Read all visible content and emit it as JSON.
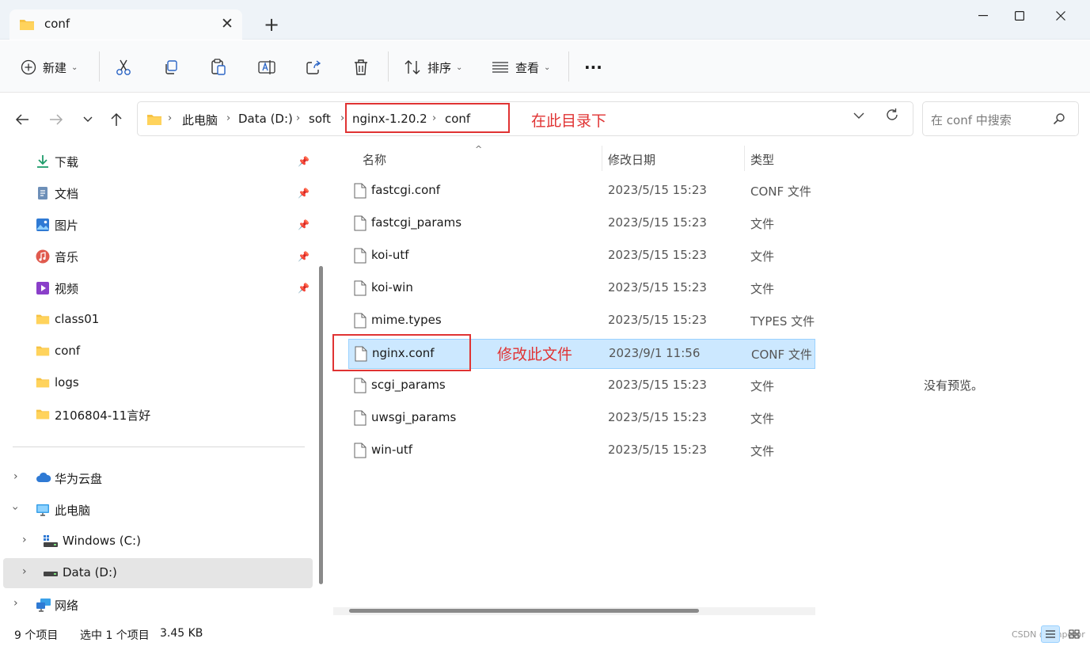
{
  "window": {
    "tab_title": "conf",
    "tab_close": "✕",
    "new_tab": "+"
  },
  "toolbar": {
    "new_label": "新建",
    "sort_label": "排序",
    "view_label": "查看",
    "more_label": "···"
  },
  "address": {
    "crumbs": [
      "此电脑",
      "Data (D:)",
      "soft",
      "nginx-1.20.2",
      "conf"
    ],
    "search_placeholder": "在 conf 中搜索"
  },
  "annotations": {
    "dir_note": "在此目录下",
    "file_note": "修改此文件"
  },
  "sidebar": {
    "quick": [
      "下载",
      "文档",
      "图片",
      "音乐",
      "视频",
      "class01",
      "conf",
      "logs",
      "2106804-11言好"
    ],
    "tree": [
      "华为云盘",
      "此电脑",
      "Windows (C:)",
      "Data (D:)",
      "网络"
    ]
  },
  "columns": {
    "name": "名称",
    "date": "修改日期",
    "type": "类型"
  },
  "files": [
    {
      "name": "fastcgi.conf",
      "date": "2023/5/15 15:23",
      "type": "CONF 文件"
    },
    {
      "name": "fastcgi_params",
      "date": "2023/5/15 15:23",
      "type": "文件"
    },
    {
      "name": "koi-utf",
      "date": "2023/5/15 15:23",
      "type": "文件"
    },
    {
      "name": "koi-win",
      "date": "2023/5/15 15:23",
      "type": "文件"
    },
    {
      "name": "mime.types",
      "date": "2023/5/15 15:23",
      "type": "TYPES 文件"
    },
    {
      "name": "nginx.conf",
      "date": "2023/9/1 11:56",
      "type": "CONF 文件"
    },
    {
      "name": "scgi_params",
      "date": "2023/5/15 15:23",
      "type": "文件"
    },
    {
      "name": "uwsgi_params",
      "date": "2023/5/15 15:23",
      "type": "文件"
    },
    {
      "name": "win-utf",
      "date": "2023/5/15 15:23",
      "type": "文件"
    }
  ],
  "preview": {
    "empty_text": "没有预览。"
  },
  "status": {
    "count": "9 个项目",
    "selection": "选中 1 个项目",
    "size": "3.45 KB",
    "watermark": "CSDN @Emperor"
  },
  "colors": {
    "annotation": "#e03333",
    "selection_bg": "#cce8ff",
    "selection_border": "#99d1ff",
    "folder": "#f6c244"
  }
}
